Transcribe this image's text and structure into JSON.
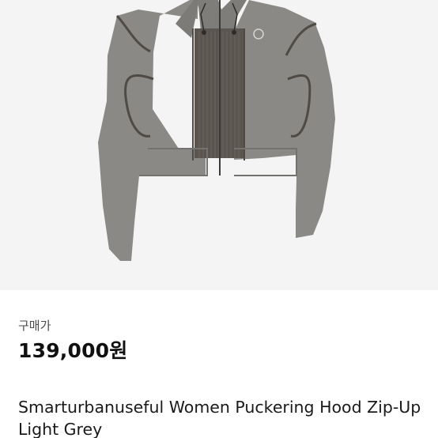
{
  "product": {
    "image_alt": "Smarturbanuseful Women Puckering Hood Zip-Up Light Grey",
    "price_label": "구매가",
    "price": "139,000원",
    "name": "Smarturbanuseful Women Puckering Hood Zip-Up Light Grey"
  },
  "colors": {
    "image_background": "#f4f4f4",
    "garment": "#8b8986",
    "garment_shadow": "#7d7b78",
    "piping": "#4f4a44",
    "ribbed_panel": "#5b554f",
    "text_primary": "#111111",
    "text_secondary": "#4a4a4a"
  }
}
